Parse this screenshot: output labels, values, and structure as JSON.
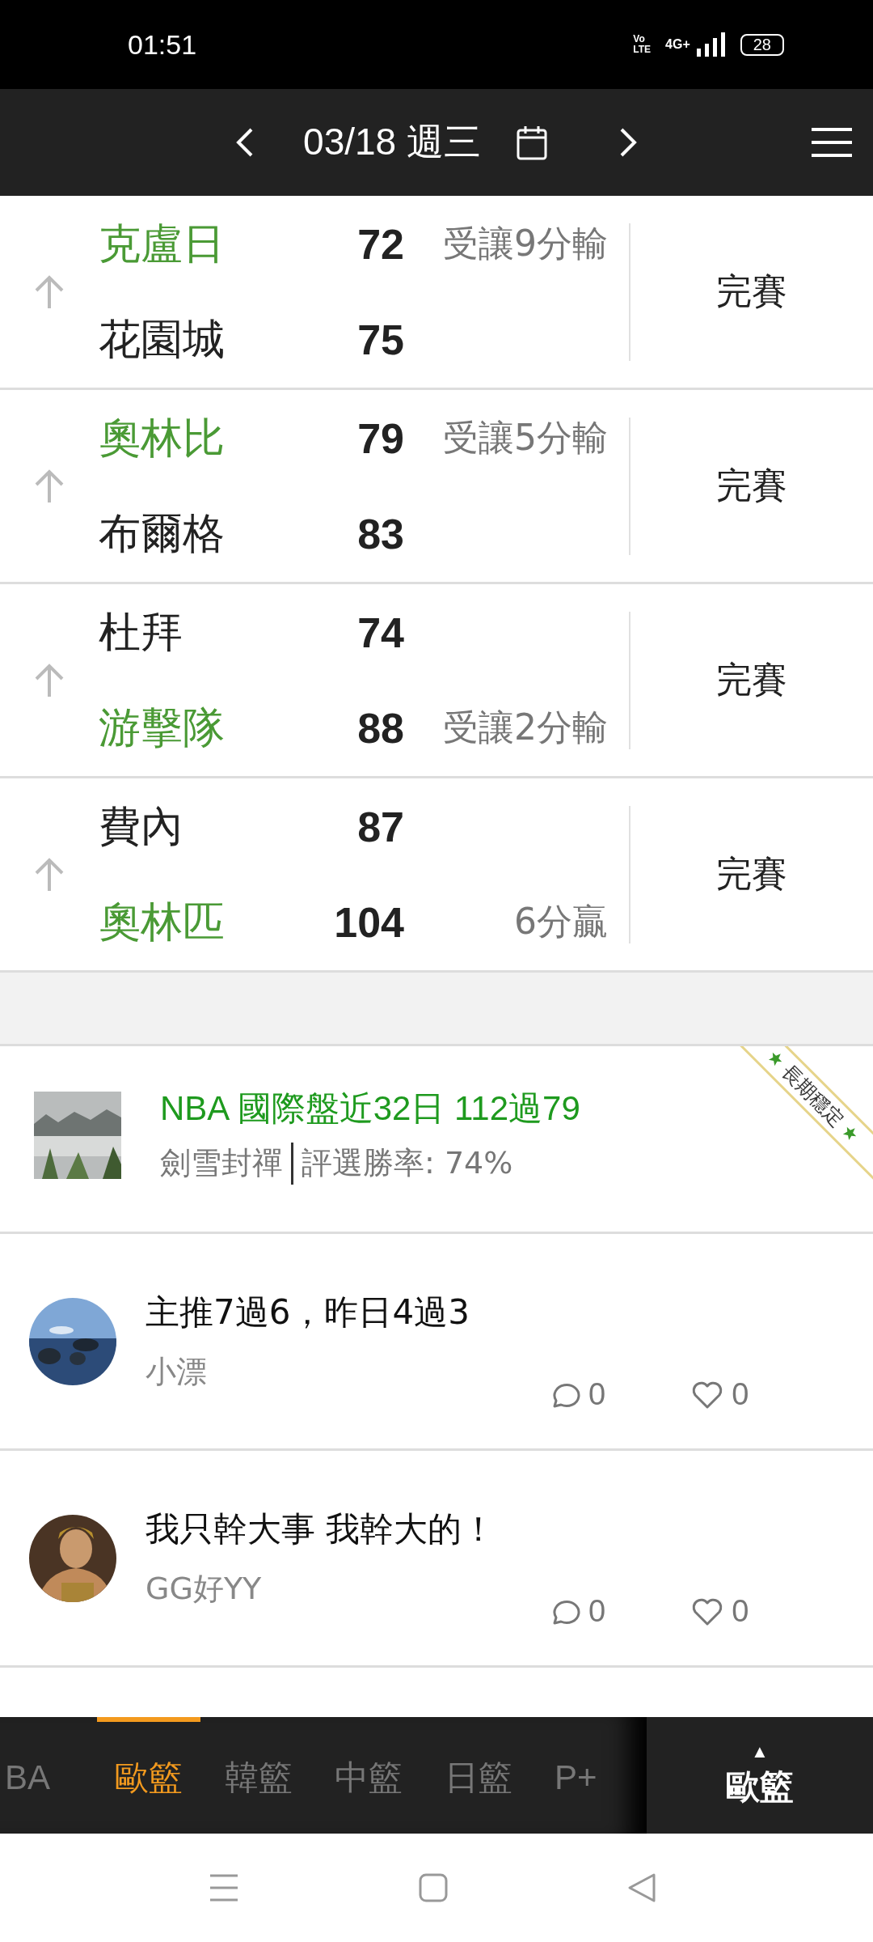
{
  "status_bar": {
    "time": "01:51",
    "volte": [
      "Vo",
      "LTE"
    ],
    "network": "4G+",
    "battery": "28"
  },
  "header": {
    "date": "03/18 週三"
  },
  "games": [
    {
      "status": "完賽",
      "teams": [
        {
          "name": "克盧日",
          "score": "72",
          "note": "受讓9分輸",
          "highlighted": true
        },
        {
          "name": "花園城",
          "score": "75",
          "highlighted": false
        }
      ]
    },
    {
      "status": "完賽",
      "teams": [
        {
          "name": "奧林比",
          "score": "79",
          "note": "受讓5分輸",
          "highlighted": true
        },
        {
          "name": "布爾格",
          "score": "83",
          "highlighted": false
        }
      ]
    },
    {
      "status": "完賽",
      "teams": [
        {
          "name": "杜拜",
          "score": "74",
          "highlighted": false
        },
        {
          "name": "游擊隊",
          "score": "88",
          "note": "受讓2分輸",
          "highlighted": true
        }
      ]
    },
    {
      "status": "完賽",
      "teams": [
        {
          "name": "費內",
          "score": "87",
          "highlighted": false
        },
        {
          "name": "奧林匹",
          "score": "104",
          "note": "6分贏",
          "highlighted": true
        }
      ]
    }
  ],
  "featured_post": {
    "title": "NBA 國際盤近32日 112過79",
    "author": "劍雪封禪",
    "stat": "評選勝率: 74%",
    "ribbon": "長期穩定"
  },
  "posts": [
    {
      "title": "主推7過6，昨日4過3",
      "author": "小漂",
      "comments": "0",
      "likes": "0"
    },
    {
      "title": "我只幹大事 我幹大的！",
      "author": "GG好YY",
      "comments": "0",
      "likes": "0"
    }
  ],
  "league_tabs": [
    {
      "label": "BA",
      "selected": false
    },
    {
      "label": "歐籃",
      "selected": true
    },
    {
      "label": "韓籃",
      "selected": false
    },
    {
      "label": "中籃",
      "selected": false
    },
    {
      "label": "日籃",
      "selected": false
    },
    {
      "label": "P+",
      "selected": false
    }
  ],
  "current_league": {
    "arrow": "▲",
    "label": "歐籃"
  }
}
